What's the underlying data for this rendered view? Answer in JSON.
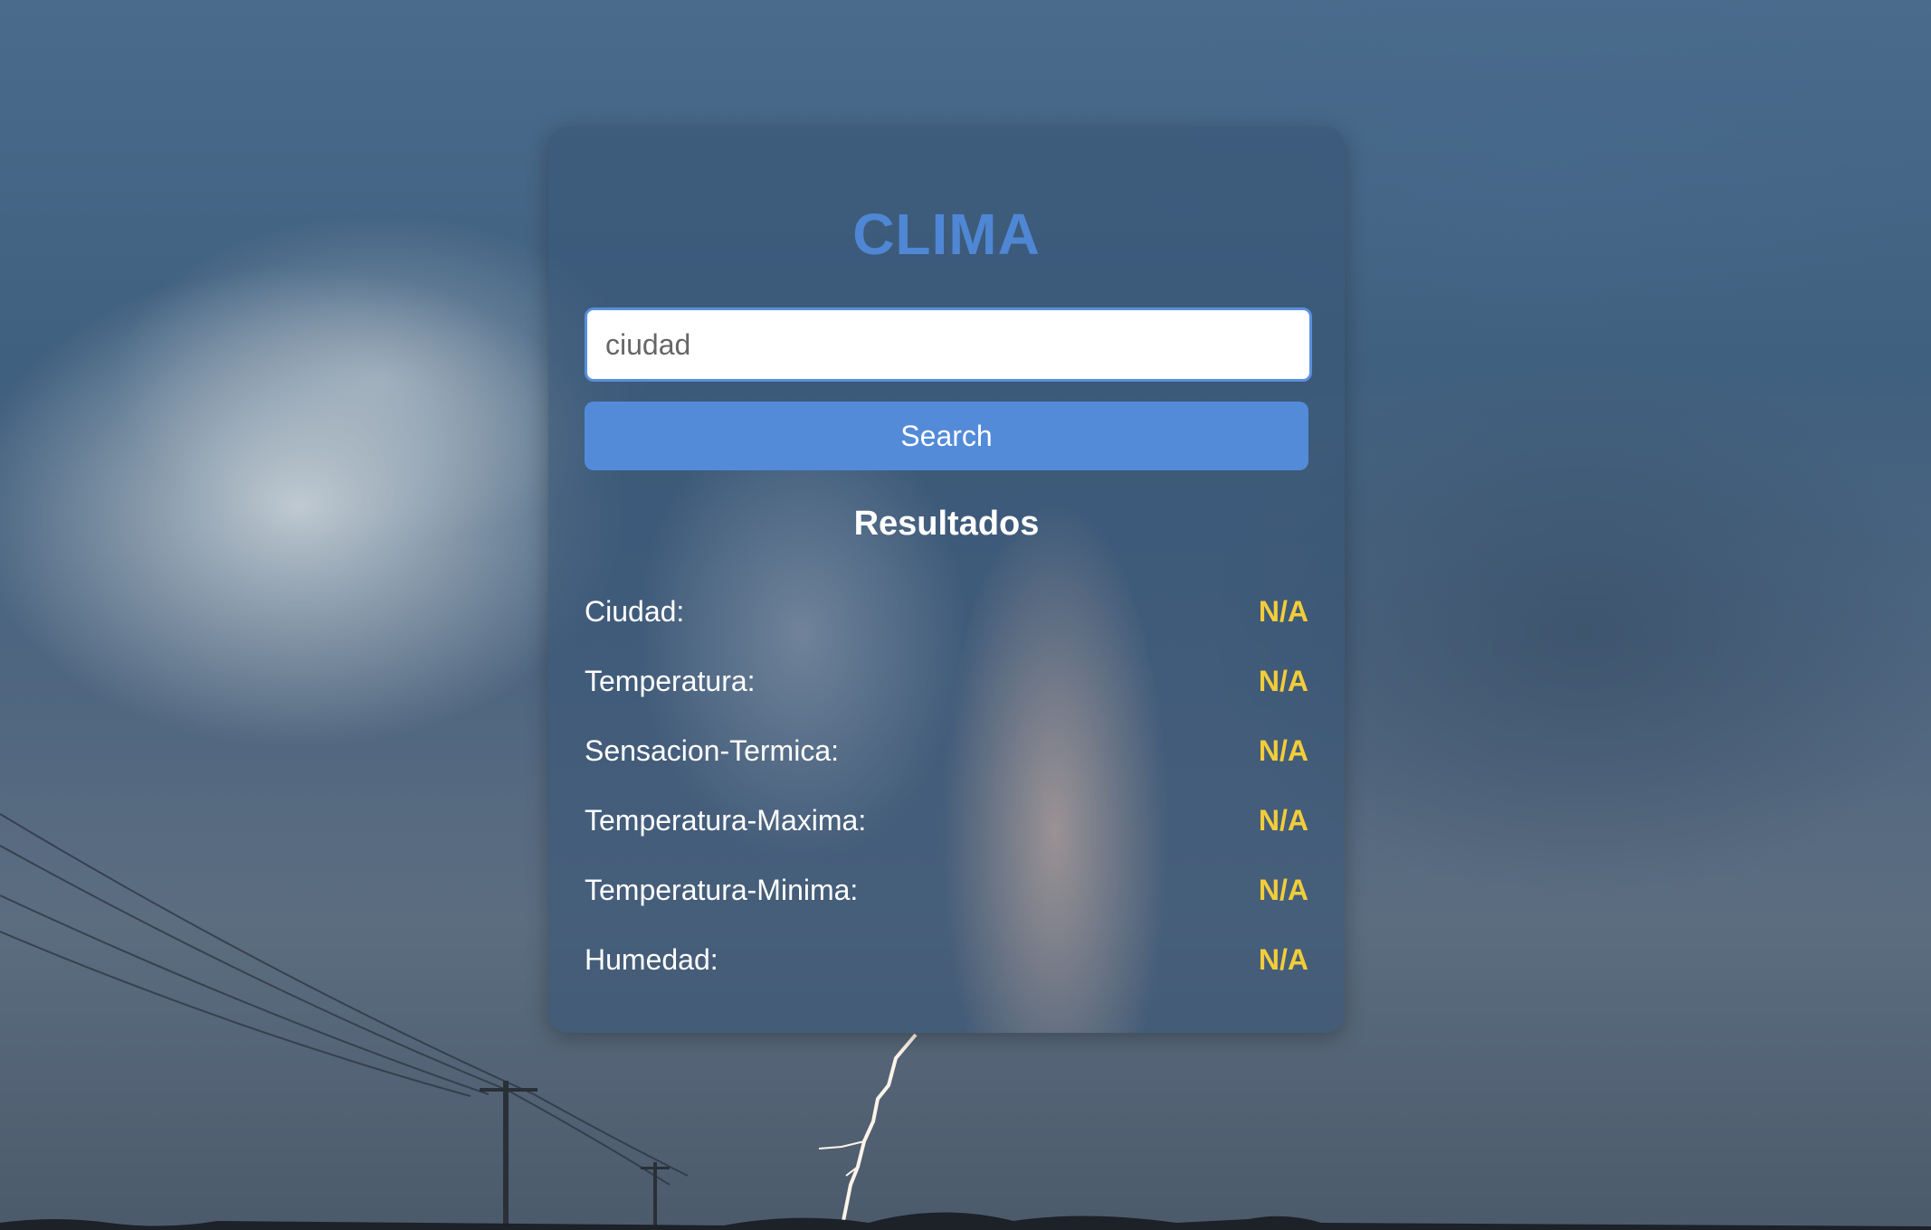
{
  "app": {
    "title": "CLIMA"
  },
  "search": {
    "placeholder": "ciudad",
    "value": "",
    "button_label": "Search"
  },
  "results": {
    "heading": "Resultados",
    "rows": [
      {
        "label": "Ciudad:",
        "value": "N/A"
      },
      {
        "label": "Temperatura:",
        "value": "N/A"
      },
      {
        "label": "Sensacion-Termica:",
        "value": "N/A"
      },
      {
        "label": "Temperatura-Maxima:",
        "value": "N/A"
      },
      {
        "label": "Temperatura-Minima:",
        "value": "N/A"
      },
      {
        "label": "Humedad:",
        "value": "N/A"
      }
    ]
  },
  "colors": {
    "title": "#4f87d4",
    "button": "#538bd9",
    "value": "#f2cd3a",
    "card": "rgba(56,86,118,0.62)"
  },
  "background": {
    "description_icon": "storm-sky-lightning-image"
  }
}
